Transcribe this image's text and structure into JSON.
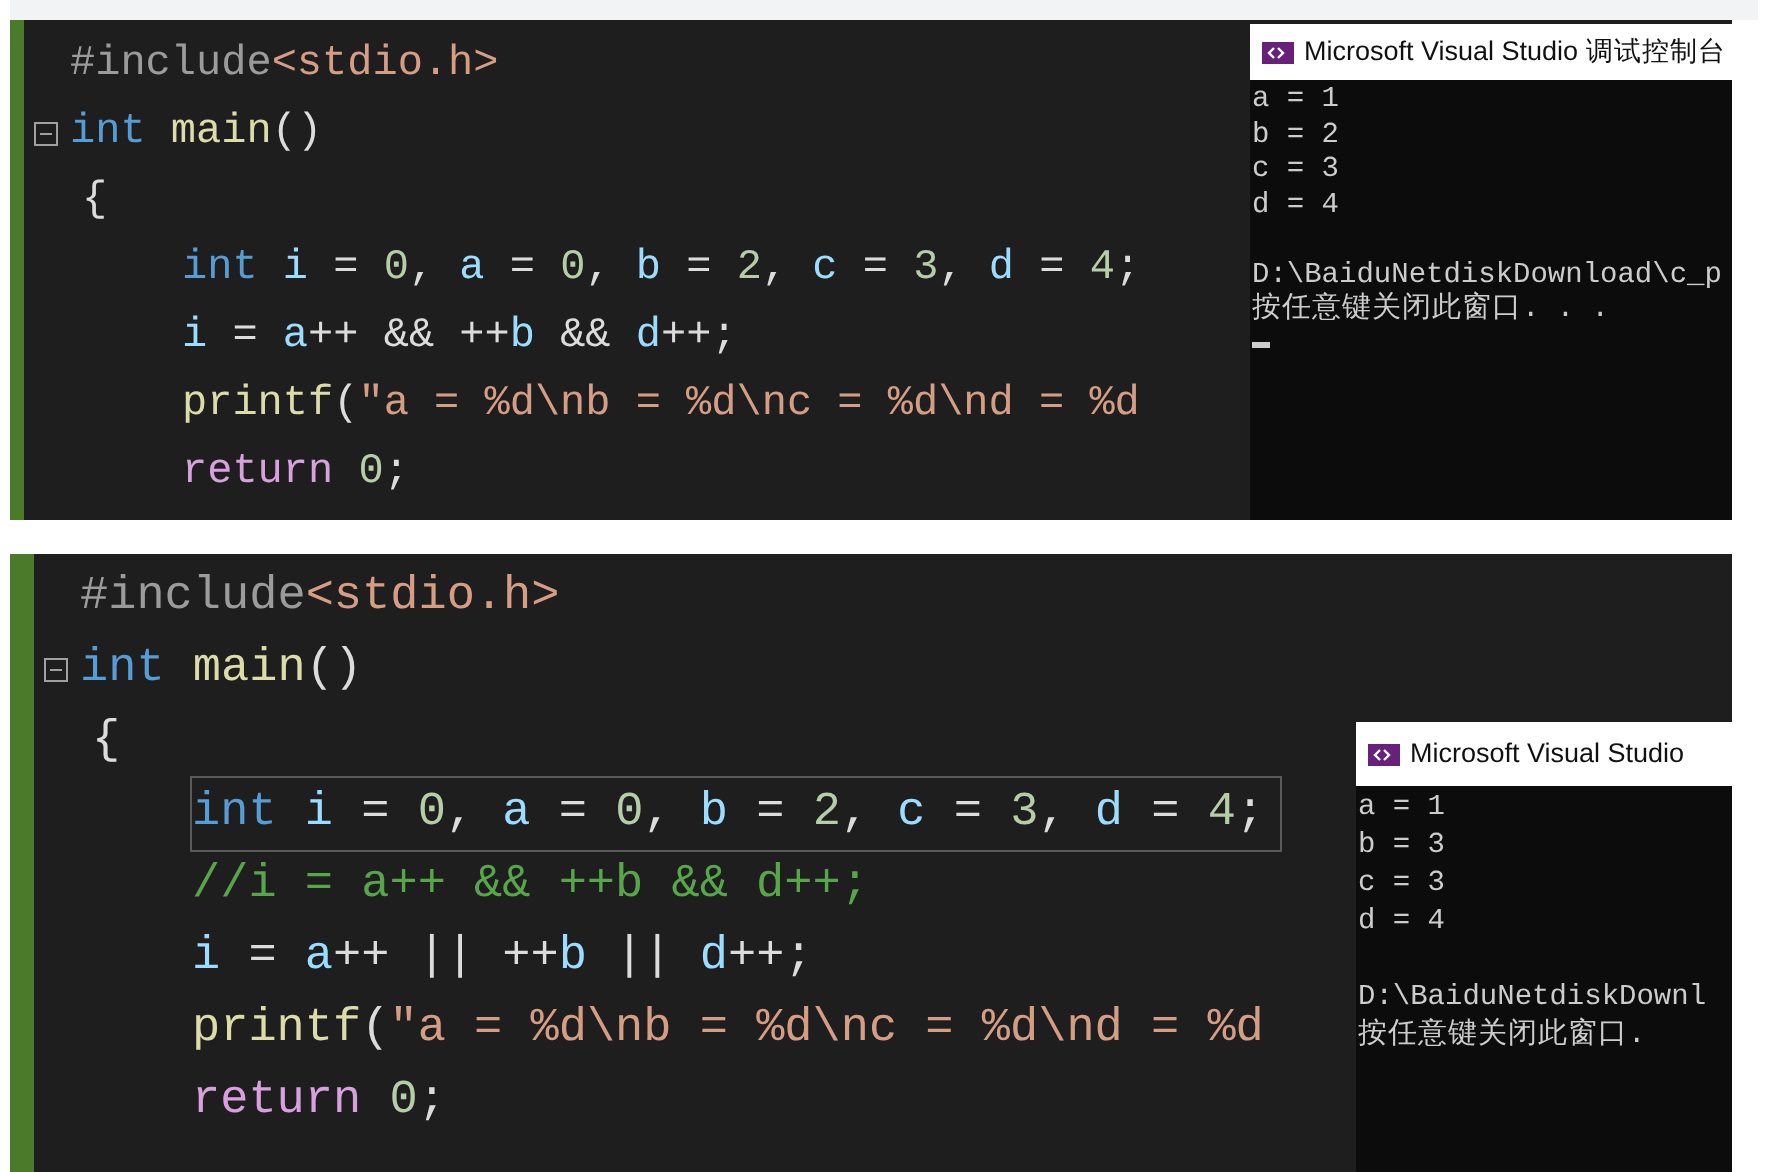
{
  "panels": [
    {
      "code": [
        {
          "current": false,
          "tokens": [
            {
              "kind": "preproc",
              "text": "#include"
            },
            {
              "kind": "string",
              "text": "<stdio.h>"
            }
          ]
        },
        {
          "current": false,
          "expanded": true,
          "tokens": [
            {
              "kind": "keyword",
              "text": "int "
            },
            {
              "kind": "func",
              "text": "main"
            },
            {
              "kind": "plain",
              "text": "()"
            }
          ],
          "children": [
            {
              "current": false,
              "tokens": [
                {
                  "kind": "plain",
                  "text": "{"
                }
              ],
              "children": [
                {
                  "current": false,
                  "tokens": [
                    {
                      "kind": "keyword",
                      "text": "int "
                    },
                    {
                      "kind": "ident",
                      "text": "i"
                    },
                    {
                      "kind": "plain",
                      "text": " = "
                    },
                    {
                      "kind": "number",
                      "text": "0"
                    },
                    {
                      "kind": "plain",
                      "text": ", "
                    },
                    {
                      "kind": "ident",
                      "text": "a"
                    },
                    {
                      "kind": "plain",
                      "text": " = "
                    },
                    {
                      "kind": "number",
                      "text": "0"
                    },
                    {
                      "kind": "plain",
                      "text": ", "
                    },
                    {
                      "kind": "ident",
                      "text": "b"
                    },
                    {
                      "kind": "plain",
                      "text": " = "
                    },
                    {
                      "kind": "number",
                      "text": "2"
                    },
                    {
                      "kind": "plain",
                      "text": ", "
                    },
                    {
                      "kind": "ident",
                      "text": "c"
                    },
                    {
                      "kind": "plain",
                      "text": " = "
                    },
                    {
                      "kind": "number",
                      "text": "3"
                    },
                    {
                      "kind": "plain",
                      "text": ", "
                    },
                    {
                      "kind": "ident",
                      "text": "d"
                    },
                    {
                      "kind": "plain",
                      "text": " = "
                    },
                    {
                      "kind": "number",
                      "text": "4"
                    },
                    {
                      "kind": "plain",
                      "text": ";"
                    }
                  ]
                },
                {
                  "current": false,
                  "tokens": [
                    {
                      "kind": "ident",
                      "text": "i"
                    },
                    {
                      "kind": "plain",
                      "text": " = "
                    },
                    {
                      "kind": "ident",
                      "text": "a"
                    },
                    {
                      "kind": "plain",
                      "text": "++ && ++"
                    },
                    {
                      "kind": "ident",
                      "text": "b"
                    },
                    {
                      "kind": "plain",
                      "text": " && "
                    },
                    {
                      "kind": "ident",
                      "text": "d"
                    },
                    {
                      "kind": "plain",
                      "text": "++;"
                    }
                  ]
                },
                {
                  "current": false,
                  "tokens": [
                    {
                      "kind": "func",
                      "text": "printf"
                    },
                    {
                      "kind": "plain",
                      "text": "("
                    },
                    {
                      "kind": "string",
                      "text": "\"a = %d\\nb = %d\\nc = %d\\nd = %d"
                    }
                  ]
                },
                {
                  "current": false,
                  "tokens": [
                    {
                      "kind": "control",
                      "text": "return "
                    },
                    {
                      "kind": "number",
                      "text": "0"
                    },
                    {
                      "kind": "plain",
                      "text": ";"
                    }
                  ]
                }
              ]
            }
          ]
        }
      ],
      "console": {
        "title": "Microsoft Visual Studio 调试控制台",
        "output_lines": [
          "a = 1",
          "b = 2",
          "c = 3",
          "d = 4"
        ],
        "message_lines": [
          "D:\\BaiduNetdiskDownload\\c_p",
          "按任意键关闭此窗口. . ."
        ],
        "cursor": true
      }
    },
    {
      "code": [
        {
          "current": false,
          "tokens": [
            {
              "kind": "preproc",
              "text": "#include"
            },
            {
              "kind": "string",
              "text": "<stdio.h>"
            }
          ]
        },
        {
          "current": false,
          "expanded": true,
          "tokens": [
            {
              "kind": "keyword",
              "text": "int "
            },
            {
              "kind": "func",
              "text": "main"
            },
            {
              "kind": "plain",
              "text": "()"
            }
          ],
          "children": [
            {
              "current": false,
              "tokens": [
                {
                  "kind": "plain",
                  "text": "{"
                }
              ],
              "children": [
                {
                  "current": true,
                  "tokens": [
                    {
                      "kind": "keyword",
                      "text": "int "
                    },
                    {
                      "kind": "ident",
                      "text": "i"
                    },
                    {
                      "kind": "plain",
                      "text": " = "
                    },
                    {
                      "kind": "number",
                      "text": "0"
                    },
                    {
                      "kind": "plain",
                      "text": ", "
                    },
                    {
                      "kind": "ident",
                      "text": "a"
                    },
                    {
                      "kind": "plain",
                      "text": " = "
                    },
                    {
                      "kind": "number",
                      "text": "0"
                    },
                    {
                      "kind": "plain",
                      "text": ", "
                    },
                    {
                      "kind": "ident",
                      "text": "b"
                    },
                    {
                      "kind": "plain",
                      "text": " = "
                    },
                    {
                      "kind": "number",
                      "text": "2"
                    },
                    {
                      "kind": "plain",
                      "text": ", "
                    },
                    {
                      "kind": "ident",
                      "text": "c"
                    },
                    {
                      "kind": "plain",
                      "text": " = "
                    },
                    {
                      "kind": "number",
                      "text": "3"
                    },
                    {
                      "kind": "plain",
                      "text": ", "
                    },
                    {
                      "kind": "ident",
                      "text": "d"
                    },
                    {
                      "kind": "plain",
                      "text": " = "
                    },
                    {
                      "kind": "number",
                      "text": "4"
                    },
                    {
                      "kind": "plain",
                      "text": ";"
                    }
                  ]
                },
                {
                  "current": false,
                  "tokens": [
                    {
                      "kind": "comment",
                      "text": "//i = a++ && ++b && d++;"
                    }
                  ]
                },
                {
                  "current": false,
                  "tokens": [
                    {
                      "kind": "ident",
                      "text": "i"
                    },
                    {
                      "kind": "plain",
                      "text": " = "
                    },
                    {
                      "kind": "ident",
                      "text": "a"
                    },
                    {
                      "kind": "plain",
                      "text": "++ || ++"
                    },
                    {
                      "kind": "ident",
                      "text": "b"
                    },
                    {
                      "kind": "plain",
                      "text": " || "
                    },
                    {
                      "kind": "ident",
                      "text": "d"
                    },
                    {
                      "kind": "plain",
                      "text": "++;"
                    }
                  ]
                },
                {
                  "current": false,
                  "tokens": [
                    {
                      "kind": "func",
                      "text": "printf"
                    },
                    {
                      "kind": "plain",
                      "text": "("
                    },
                    {
                      "kind": "string",
                      "text": "\"a = %d\\nb = %d\\nc = %d\\nd = %d"
                    }
                  ]
                },
                {
                  "current": false,
                  "tokens": [
                    {
                      "kind": "control",
                      "text": "return "
                    },
                    {
                      "kind": "number",
                      "text": "0"
                    },
                    {
                      "kind": "plain",
                      "text": ";"
                    }
                  ]
                }
              ]
            }
          ]
        }
      ],
      "console": {
        "title": "Microsoft Visual Studio",
        "output_lines": [
          "a = 1",
          "b = 3",
          "c = 3",
          "d = 4"
        ],
        "message_lines": [
          "D:\\BaiduNetdiskDownl",
          "按任意键关闭此窗口."
        ],
        "cursor": false
      }
    }
  ]
}
